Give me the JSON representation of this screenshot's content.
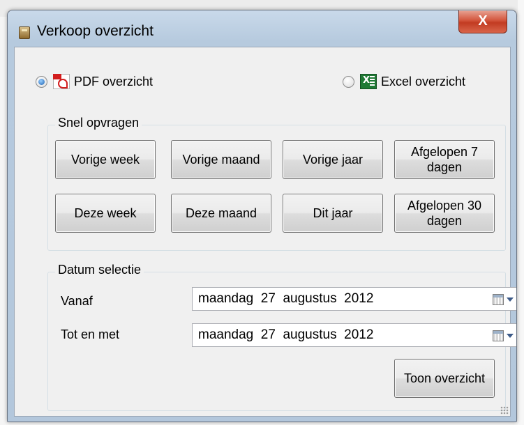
{
  "window": {
    "title": "Verkoop overzicht",
    "close_label": "X"
  },
  "format": {
    "pdf_label": "PDF overzicht",
    "pdf_selected": true,
    "excel_label": "Excel overzicht",
    "excel_selected": false
  },
  "quick": {
    "label": "Snel opvragen",
    "buttons": [
      "Vorige week",
      "Vorige maand",
      "Vorige jaar",
      "Afgelopen 7 dagen",
      "Deze week",
      "Deze maand",
      "Dit jaar",
      "Afgelopen 30 dagen"
    ]
  },
  "date": {
    "label": "Datum selectie",
    "from_label": "Vanaf",
    "from_value": "maandag  27  augustus  2012",
    "to_label": "Tot en met",
    "to_value": "maandag  27  augustus  2012",
    "show_button": "Toon overzicht"
  },
  "icons": [
    "app-icon",
    "pdf-icon",
    "excel-icon",
    "calendar-icon",
    "dropdown-arrow-icon",
    "resize-grip-icon"
  ]
}
